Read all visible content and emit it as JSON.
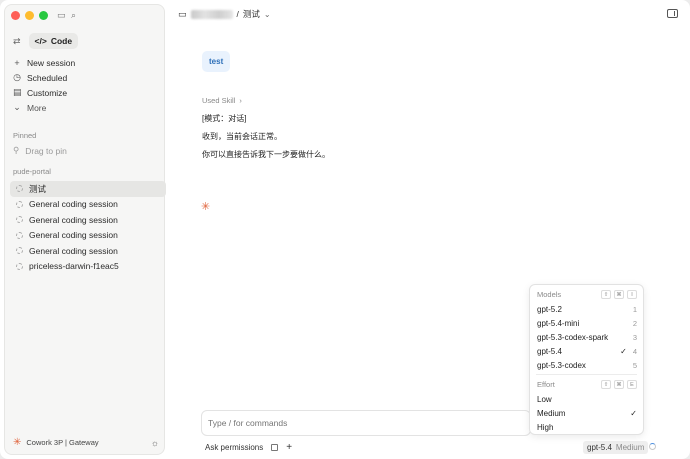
{
  "sidebar": {
    "mode_label": "Code",
    "nav": [
      {
        "label": "New session",
        "icon": "plus-icon"
      },
      {
        "label": "Scheduled",
        "icon": "clock-icon"
      },
      {
        "label": "Customize",
        "icon": "briefcase-icon"
      },
      {
        "label": "More",
        "icon": "chevron-down-icon"
      }
    ],
    "pinned_label": "Pinned",
    "drag_to_pin": "Drag to pin",
    "project_label": "pude-portal",
    "sessions": [
      {
        "label": "测试",
        "active": true
      },
      {
        "label": "General coding session"
      },
      {
        "label": "General coding session"
      },
      {
        "label": "General coding session"
      },
      {
        "label": "General coding session"
      },
      {
        "label": "priceless-darwin-f1eac5"
      }
    ],
    "footer_label": "Cowork 3P | Gateway"
  },
  "header": {
    "separator": "/",
    "title": "测试"
  },
  "conversation": {
    "user_message": "test",
    "used_skill": "Used Skill",
    "lines": [
      "[模式：对话]",
      "收到，当前会话正常。",
      "你可以直接告诉我下一步要做什么。"
    ]
  },
  "composer": {
    "placeholder": "Type / for commands",
    "ask_permissions": "Ask permissions",
    "model": "gpt-5.4",
    "effort": "Medium"
  },
  "dropdown": {
    "models_label": "Models",
    "models_keys": [
      "⇧",
      "⌘",
      "I"
    ],
    "models": [
      {
        "label": "gpt-5.2",
        "shortcut": "1"
      },
      {
        "label": "gpt-5.4-mini",
        "shortcut": "2"
      },
      {
        "label": "gpt-5.3-codex-spark",
        "shortcut": "3"
      },
      {
        "label": "gpt-5.4",
        "shortcut": "4",
        "selected": true
      },
      {
        "label": "gpt-5.3-codex",
        "shortcut": "5"
      }
    ],
    "effort_label": "Effort",
    "effort_keys": [
      "⇧",
      "⌘",
      "E"
    ],
    "efforts": [
      {
        "label": "Low"
      },
      {
        "label": "Medium",
        "selected": true
      },
      {
        "label": "High"
      }
    ]
  },
  "colors": {
    "accent": "#e0623a",
    "user_bubble": "#e9f2fd",
    "user_text": "#2d6fb9"
  }
}
